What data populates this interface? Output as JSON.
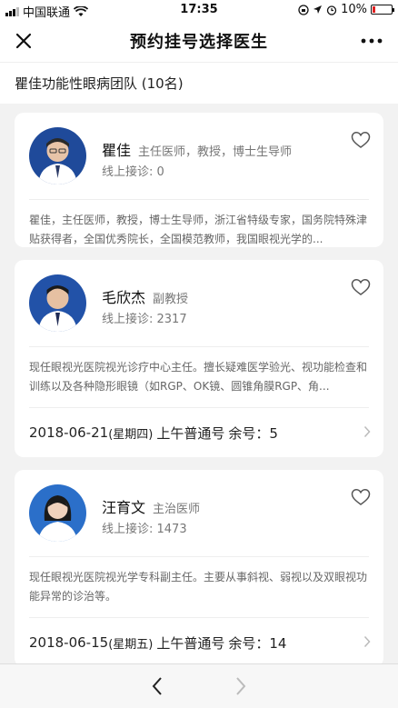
{
  "status_bar": {
    "carrier": "中国联通",
    "time": "17:35",
    "battery": "10%"
  },
  "nav": {
    "title": "预约挂号选择医生"
  },
  "team": {
    "label": "瞿佳功能性眼病团队 (10名)"
  },
  "doctors": [
    {
      "name": "瞿佳",
      "title": "主任医师，教授，博士生导师",
      "online": "线上接诊: 0",
      "intro": "瞿佳，主任医师，教授，博士生导师，浙江省特级专家，国务院特殊津贴获得者，全国优秀院长，全国模范教师，我国眼视光学的..."
    },
    {
      "name": "毛欣杰",
      "title": "副教授",
      "online": "线上接诊: 2317",
      "intro": "现任眼视光医院视光诊疗中心主任。擅长疑难医学验光、视功能检查和训练以及各种隐形眼镜（如RGP、OK镜、圆锥角膜RGP、角...",
      "slot": {
        "date": "2018-06-21",
        "week": "(星期四)",
        "type": "上午普通号",
        "remain": "余号：5"
      }
    },
    {
      "name": "汪育文",
      "title": "主治医师",
      "online": "线上接诊: 1473",
      "intro": "现任眼视光医院视光学专科副主任。主要从事斜视、弱视以及双眼视功能异常的诊治等。",
      "slot": {
        "date": "2018-06-15",
        "week": "(星期五)",
        "type": "上午普通号",
        "remain": "余号：14"
      }
    }
  ],
  "colors": {
    "background": "#f2f2f2",
    "card": "#ffffff",
    "text_primary": "#111111",
    "text_secondary": "#777777"
  },
  "icons": {
    "close": "close-icon",
    "more": "more-icon",
    "favorite": "heart-outline-icon",
    "chevron": "chevron-right-icon",
    "back": "back-arrow-icon",
    "forward": "forward-arrow-icon"
  }
}
